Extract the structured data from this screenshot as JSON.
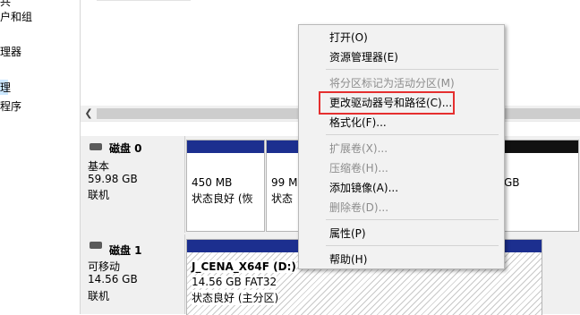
{
  "left_nav": {
    "items": [
      {
        "label": "共"
      },
      {
        "label": "户和组"
      },
      {
        "label": "理器"
      },
      {
        "label": "理"
      },
      {
        "label": "程序"
      }
    ]
  },
  "disks": [
    {
      "name": "磁盘 0",
      "type": "基本",
      "size": "59.98 GB",
      "status": "联机",
      "partitions": [
        {
          "size": "450 MB",
          "status": "状态良好 (恢"
        },
        {
          "size": "99 M",
          "status": "状态"
        },
        {
          "size": "GB",
          "status": ""
        }
      ]
    },
    {
      "name": "磁盘 1",
      "type": "可移动",
      "size": "14.56 GB",
      "status": "联机",
      "partitions": [
        {
          "label": "J_CENA_X64F  (D:)",
          "size": "14.56 GB FAT32",
          "status": "状态良好 (主分区)"
        }
      ]
    }
  ],
  "context_menu": {
    "items": [
      {
        "label": "打开(O)",
        "enabled": true
      },
      {
        "label": "资源管理器(E)",
        "enabled": true
      },
      {
        "label": "将分区标记为活动分区(M)",
        "enabled": false
      },
      {
        "label": "更改驱动器号和路径(C)...",
        "enabled": true
      },
      {
        "label": "格式化(F)...",
        "enabled": true
      },
      {
        "label": "扩展卷(X)...",
        "enabled": false
      },
      {
        "label": "压缩卷(H)...",
        "enabled": false
      },
      {
        "label": "添加镜像(A)...",
        "enabled": true
      },
      {
        "label": "删除卷(D)...",
        "enabled": false
      },
      {
        "label": "属性(P)",
        "enabled": true
      },
      {
        "label": "帮助(H)",
        "enabled": true
      }
    ]
  },
  "colors": {
    "primary_partition_bar": "#1c2f8f",
    "highlight_border": "#e52f2f",
    "menu_background": "#f2f2f2"
  }
}
